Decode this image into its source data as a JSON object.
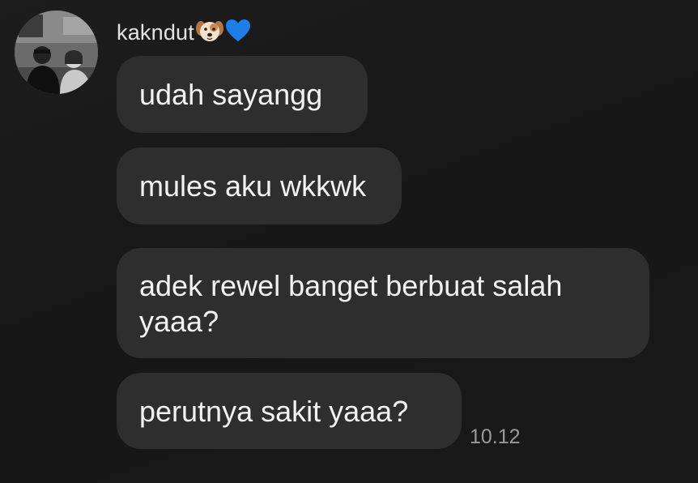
{
  "sender": {
    "name": "kakndut",
    "emojis": [
      "dog-face-emoji",
      "blue-heart-emoji"
    ]
  },
  "messages": [
    {
      "text": "udah sayangg"
    },
    {
      "text": "mules aku wkkwk"
    },
    {
      "text": "adek rewel banget berbuat salah yaaa?"
    },
    {
      "text": "perutnya sakit yaaa?"
    }
  ],
  "timestamp": "10.12",
  "colors": {
    "background": "#181818",
    "bubble": "#2e2e2e",
    "text": "#f2f2f2",
    "timestamp": "#9a9a9a",
    "heart": "#1e7ee8"
  }
}
